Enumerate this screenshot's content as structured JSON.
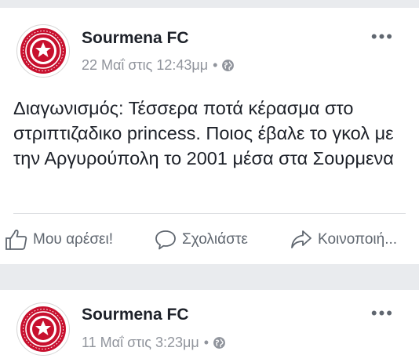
{
  "posts": [
    {
      "author": "Sourmena FC",
      "date": "22 Μαΐ στις 12:43μμ",
      "separator": "•",
      "privacy_icon": "globe-icon",
      "text": "Διαγωνισμός: Τέσσερα ποτά κέρασμα στο στριπτιζαδικο princess.  Ποιος έβαλε το γκολ με την Αργυρούπολη το 2001 μέσα στα Σουρμενα",
      "actions": {
        "like": "Μου αρέσει!",
        "comment": "Σχολιάστε",
        "share": "Κοινοποιή..."
      },
      "more_icon": "ellipsis-icon"
    },
    {
      "author": "Sourmena FC",
      "date": "11 Μαΐ στις 3:23μμ",
      "separator": "•",
      "privacy_icon": "globe-icon",
      "more_icon": "ellipsis-icon"
    }
  ],
  "colors": {
    "background": "#e9ebee",
    "card": "#ffffff",
    "text": "#1d2129",
    "muted": "#90949c",
    "action": "#606770",
    "logo_red": "#c8102e"
  }
}
